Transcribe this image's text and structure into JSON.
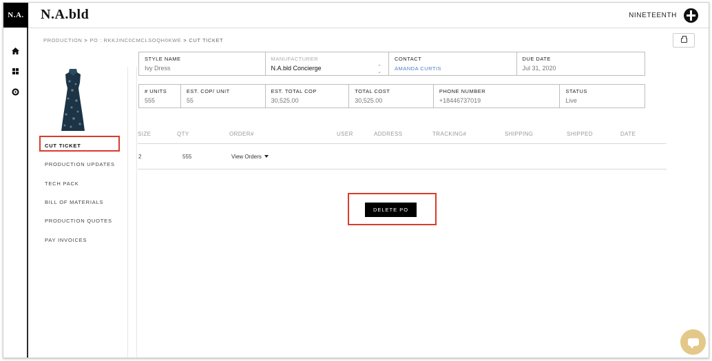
{
  "app": {
    "logo_text": "N.A.",
    "brand": "N.A.bld",
    "company": "NINETEENTH"
  },
  "rail": {
    "icons": [
      "home-icon",
      "grid-icon",
      "gear-icon"
    ]
  },
  "breadcrumb": {
    "items": [
      "PRODUCTION",
      "PO : RKKJINC0CMCLSOQH0KWE",
      "CUT TICKET"
    ],
    "separator": ">"
  },
  "side_nav": {
    "items": [
      {
        "label": "CUT TICKET",
        "active": true
      },
      {
        "label": "PRODUCTION UPDATES"
      },
      {
        "label": "TECH PACK"
      },
      {
        "label": "BILL OF MATERIALS"
      },
      {
        "label": "PRODUCTION QUOTES"
      },
      {
        "label": "PAY INVOICES"
      }
    ]
  },
  "details_top": {
    "style_name_label": "STYLE NAME",
    "style_name": "Ivy Dress",
    "manufacturer_label": "MANUFACTURER",
    "manufacturer": "N.A.bld Concierge",
    "contact_label": "CONTACT",
    "contact": "AMANDA CURTIS",
    "due_date_label": "DUE DATE",
    "due_date": "Jul 31, 2020"
  },
  "details_bottom": {
    "units_label": "# UNITS",
    "units": "555",
    "cop_unit_label": "EST. COP/ UNIT",
    "cop_unit": "55",
    "total_cop_label": "EST. TOTAL COP",
    "total_cop": "30,525.00",
    "total_cost_label": "TOTAL COST",
    "total_cost": "30,525.00",
    "phone_label": "PHONE NUMBER",
    "phone": "+18446737019",
    "status_label": "STATUS",
    "status": "Live"
  },
  "table": {
    "headers": [
      "SIZE",
      "QTY",
      "ORDER#",
      "USER",
      "ADDRESS",
      "TRACKING#",
      "SHIPPING",
      "SHIPPED",
      "DATE"
    ],
    "row": {
      "size": "2",
      "qty": "555",
      "orders_label": "View Orders"
    }
  },
  "actions": {
    "delete_label": "DELETE PO"
  },
  "colors": {
    "highlight": "#d93a2b",
    "link": "#4a7fc1",
    "chat": "#e4c88a"
  }
}
